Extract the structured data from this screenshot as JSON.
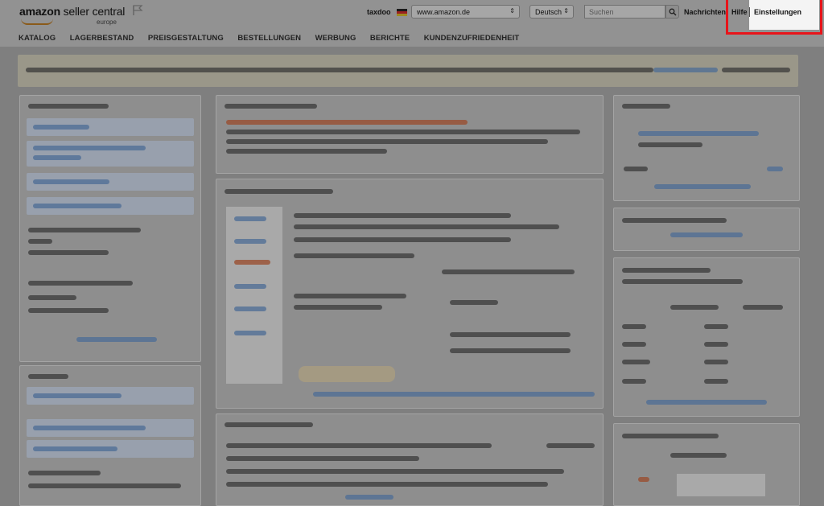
{
  "header": {
    "logo_bold": "amazon",
    "logo_rest": " seller central",
    "logo_sub": "europe",
    "seller_name": "taxdoo",
    "marketplace": "www.amazon.de",
    "language": "Deutsch",
    "search_placeholder": "Suchen",
    "messages": "Nachrichten",
    "help": "Hilfe",
    "settings": "Einstellungen"
  },
  "nav": {
    "items": [
      "KATALOG",
      "LAGERBESTAND",
      "PREISGESTALTUNG",
      "BESTELLUNGEN",
      "WERBUNG",
      "BERICHTE",
      "KUNDENZUFRIEDENHEIT"
    ]
  },
  "colors": {
    "highlight": "#e8141a"
  }
}
